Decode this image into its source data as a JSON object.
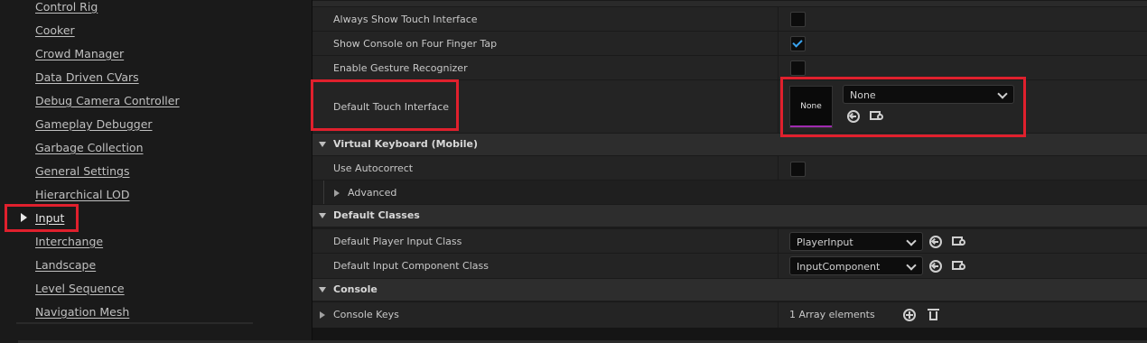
{
  "sidebar": {
    "items": [
      {
        "label": "Control Rig"
      },
      {
        "label": "Cooker"
      },
      {
        "label": "Crowd Manager"
      },
      {
        "label": "Data Driven CVars"
      },
      {
        "label": "Debug Camera Controller"
      },
      {
        "label": "Gameplay Debugger"
      },
      {
        "label": "Garbage Collection"
      },
      {
        "label": "General Settings"
      },
      {
        "label": "Hierarchical LOD"
      },
      {
        "label": "Input",
        "selected": true
      },
      {
        "label": "Interchange"
      },
      {
        "label": "Landscape"
      },
      {
        "label": "Level Sequence"
      },
      {
        "label": "Navigation Mesh"
      }
    ]
  },
  "mobile": {
    "always_show_touch": {
      "label": "Always Show Touch Interface",
      "checked": false
    },
    "show_console_four_finger": {
      "label": "Show Console on Four Finger Tap",
      "checked": true
    },
    "enable_gesture": {
      "label": "Enable Gesture Recognizer",
      "checked": false
    },
    "default_touch_interface": {
      "label": "Default Touch Interface",
      "thumbnail_label": "None",
      "value": "None"
    }
  },
  "virtual_keyboard": {
    "title": "Virtual Keyboard (Mobile)",
    "use_autocorrect": {
      "label": "Use Autocorrect",
      "checked": false
    },
    "advanced_label": "Advanced"
  },
  "default_classes": {
    "title": "Default Classes",
    "player_input": {
      "label": "Default Player Input Class",
      "value": "PlayerInput"
    },
    "input_component": {
      "label": "Default Input Component Class",
      "value": "InputComponent"
    }
  },
  "console": {
    "title": "Console",
    "console_keys": {
      "label": "Console Keys",
      "value": "1 Array elements"
    }
  },
  "colors": {
    "highlight": "#e0202d",
    "check": "#3aa4f0",
    "asset_bar": "#a02bb0"
  },
  "icons": [
    "triangle-right-icon",
    "chevron-down-icon",
    "use-selected-icon",
    "browse-icon",
    "plus-icon",
    "trash-icon",
    "checkmark-icon"
  ]
}
